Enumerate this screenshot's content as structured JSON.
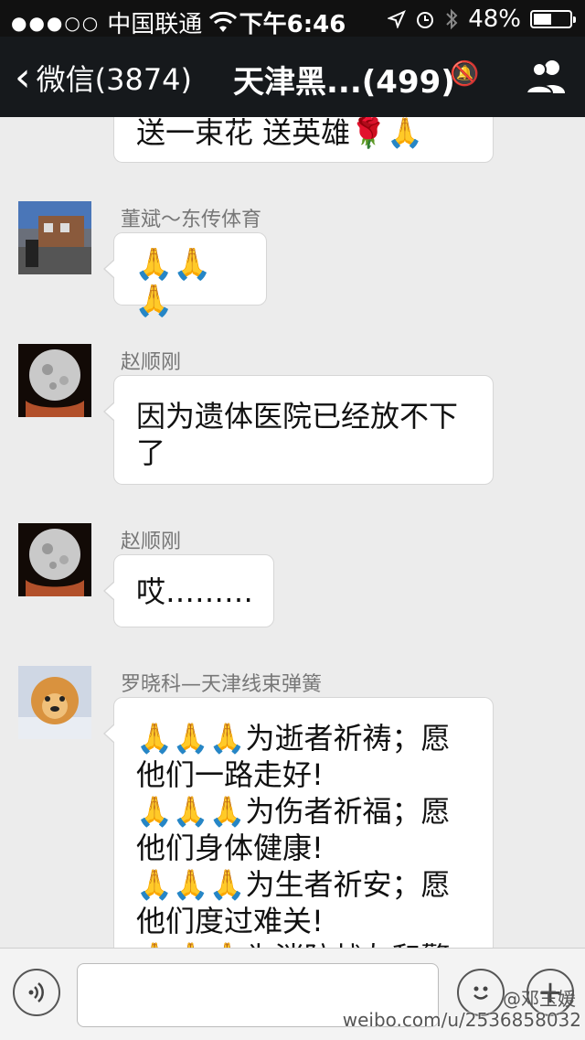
{
  "status_bar": {
    "carrier": "中国联通",
    "time": "下午6:46",
    "battery": "48%"
  },
  "nav": {
    "back_label": "微信(3874)",
    "title": "天津黑...(499)"
  },
  "messages": [
    {
      "text": "送一束花 送英雄🌹🙏"
    },
    {
      "sender": "董斌～东传体育",
      "text": "🙏🙏🙏"
    },
    {
      "sender": "赵顺刚",
      "text": "因为遗体医院已经放不下了"
    },
    {
      "sender": "赵顺刚",
      "text": "哎………"
    },
    {
      "sender": "罗晓科—天津线束弹簧",
      "lines": [
        "🙏🙏🙏为逝者祈祷；愿",
        "他们一路走好!",
        "🙏🙏🙏为伤者祈福；愿",
        "他们身体健康!",
        "🙏🙏🙏为生者祈安；愿",
        "他们度过难关!",
        "🙏🙏🙏为消防战友和警"
      ]
    }
  ],
  "watermark": {
    "user": "@邓玉媛",
    "url": "weibo.com/u/2536858032"
  },
  "colors": {
    "nav_bg": "#16191c",
    "chat_bg": "#ececec",
    "bubble_bg": "#ffffff"
  }
}
